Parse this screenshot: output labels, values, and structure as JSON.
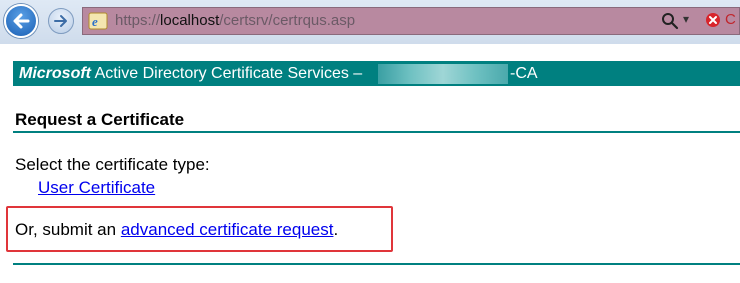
{
  "browser": {
    "url_prefix": "https://",
    "url_host": "localhost",
    "url_path": "/certsrv/certrqus.asp",
    "address_drop_symbol": "▾",
    "address_cut_text": "C"
  },
  "header": {
    "brand": "Microsoft",
    "title_prefix": " Active Directory Certificate Services  –",
    "title_suffix": "-CA"
  },
  "page": {
    "title": "Request a Certificate",
    "select_prompt": "Select the certificate type:",
    "user_certificate_link": "User Certificate",
    "advanced_prefix": "Or, submit an ",
    "advanced_link": "advanced certificate request",
    "advanced_suffix": "."
  },
  "colors": {
    "teal": "#008080",
    "link": "#0000ee",
    "highlight": "#e0353a"
  },
  "icons": {
    "back": "back-arrow-icon",
    "forward": "forward-arrow-icon",
    "page": "ie-page-icon",
    "search": "search-icon",
    "stop": "stop-icon"
  }
}
